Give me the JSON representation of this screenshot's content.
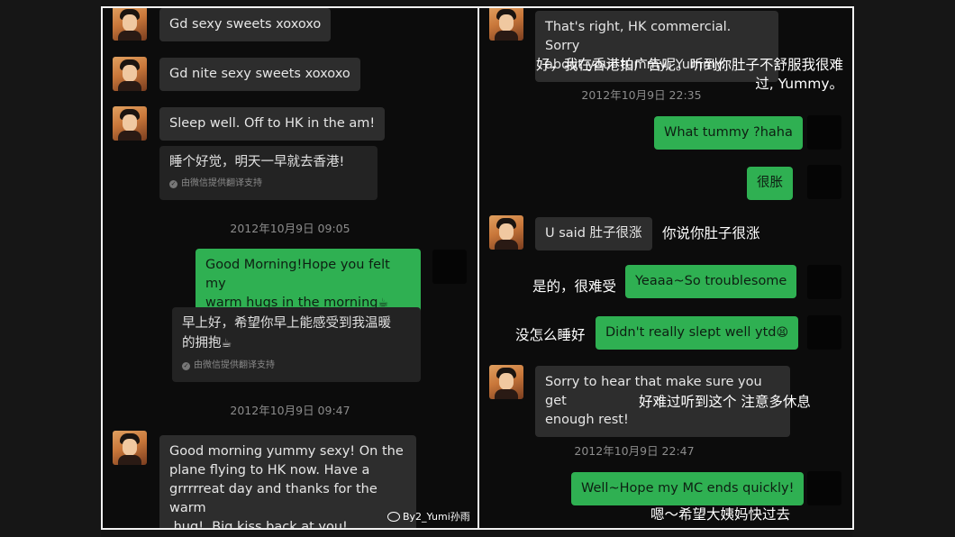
{
  "left": {
    "msg1": "Gd sexy sweets xoxoxo",
    "msg2": "Gd nite sexy sweets xoxoxo",
    "msg3": "Sleep well.  Off to HK in the am!",
    "msg3_trans": "睡个好觉，明天一早就去香港!",
    "trans_note": "由微信提供翻译支持",
    "ts1": "2012年10月9日 09:05",
    "msg4_line1": "Good Morning!Hope you felt my",
    "msg4_line2": "warm hugs in the morning",
    "msg4_trans_line1": "早上好，希望你早上能感受到我温暖",
    "msg4_trans_line2": "的拥抱",
    "cup_emoji": "☕",
    "ts2": "2012年10月9日 09:47",
    "msg5_line1": "Good morning yummy sexy!  On the",
    "msg5_line2": "plane flying to HK now.  Have a",
    "msg5_line3": "grrrrreat day and thanks for the warm",
    "msg5_line4": " hug!  Big kiss back at you!",
    "watermark": "By2_Yumi孙雨"
  },
  "right": {
    "msg1_line1": "That's right, HK commercial.  Sorry",
    "msg1_line2": "about your tummy, Yummy.",
    "cap1_line1": "好，我在香港拍广告呢。听到你肚子不舒服我很难",
    "cap1_line2": "过, Yummy。",
    "ts1": "2012年10月9日 22:35",
    "msg2": "What tummy ?haha",
    "msg3": "很胀",
    "msg4": "U said 肚子很涨",
    "cap4": "你说你肚子很涨",
    "msg5": "Yeaaa~So troublesome",
    "cap5": "是的，很难受",
    "msg6": "Didn't really slept well ytd",
    "msg6_emoji": "😫",
    "cap6": "没怎么睡好",
    "msg7_line1": "Sorry to hear that make sure you get",
    "msg7_line2": "enough rest!",
    "cap7": "好难过听到这个 注意多休息",
    "ts2": "2012年10月9日 22:47",
    "msg8": "Well~Hope my MC ends quickly!",
    "cap8": "嗯～希望大姨妈快过去"
  },
  "colors": {
    "green_bubble": "#2fb052",
    "gray_bubble": "#2d2d2d",
    "panel_border": "#f2f2f2"
  }
}
